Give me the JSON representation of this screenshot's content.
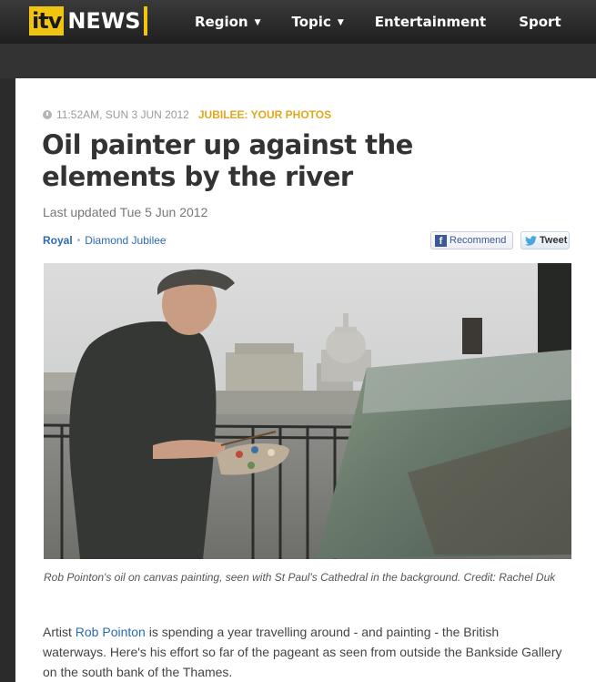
{
  "header": {
    "logo_itv": "itv",
    "logo_news": "NEWS",
    "nav": {
      "region": "Region",
      "topic": "Topic",
      "entertainment": "Entertainment",
      "sport": "Sport"
    }
  },
  "article": {
    "timestamp": "11:52AM, SUN 3 JUN 2012",
    "category": "JUBILEE: YOUR PHOTOS",
    "title": "Oil painter up against the elements by the river",
    "last_updated": "Last updated Tue 5 Jun 2012",
    "tags": [
      "Royal",
      "Diamond Jubilee"
    ],
    "social": {
      "recommend_label": "Recommend",
      "tweet_label": "Tweet"
    },
    "image_alt": "Rob Pointon's oil on canvas painting, seen with St Paul's Cathedral in the background",
    "caption": "Rob Pointon's oil on canvas painting, seen with St Paul's Cathedral in the background. Credit: Rachel Duk",
    "body": {
      "prefix": "Artist ",
      "link": "Rob Pointon",
      "suffix": " is spending a year travelling around - and painting - the British waterways. Here's his effort so far of the pageant as seen from outside the Bankside Gallery on the south bank of the Thames."
    }
  },
  "colors": {
    "brand_yellow": "#f1c40f",
    "category": "#e0a81e",
    "link": "#2a6bb5",
    "facebook": "#3b5998"
  }
}
